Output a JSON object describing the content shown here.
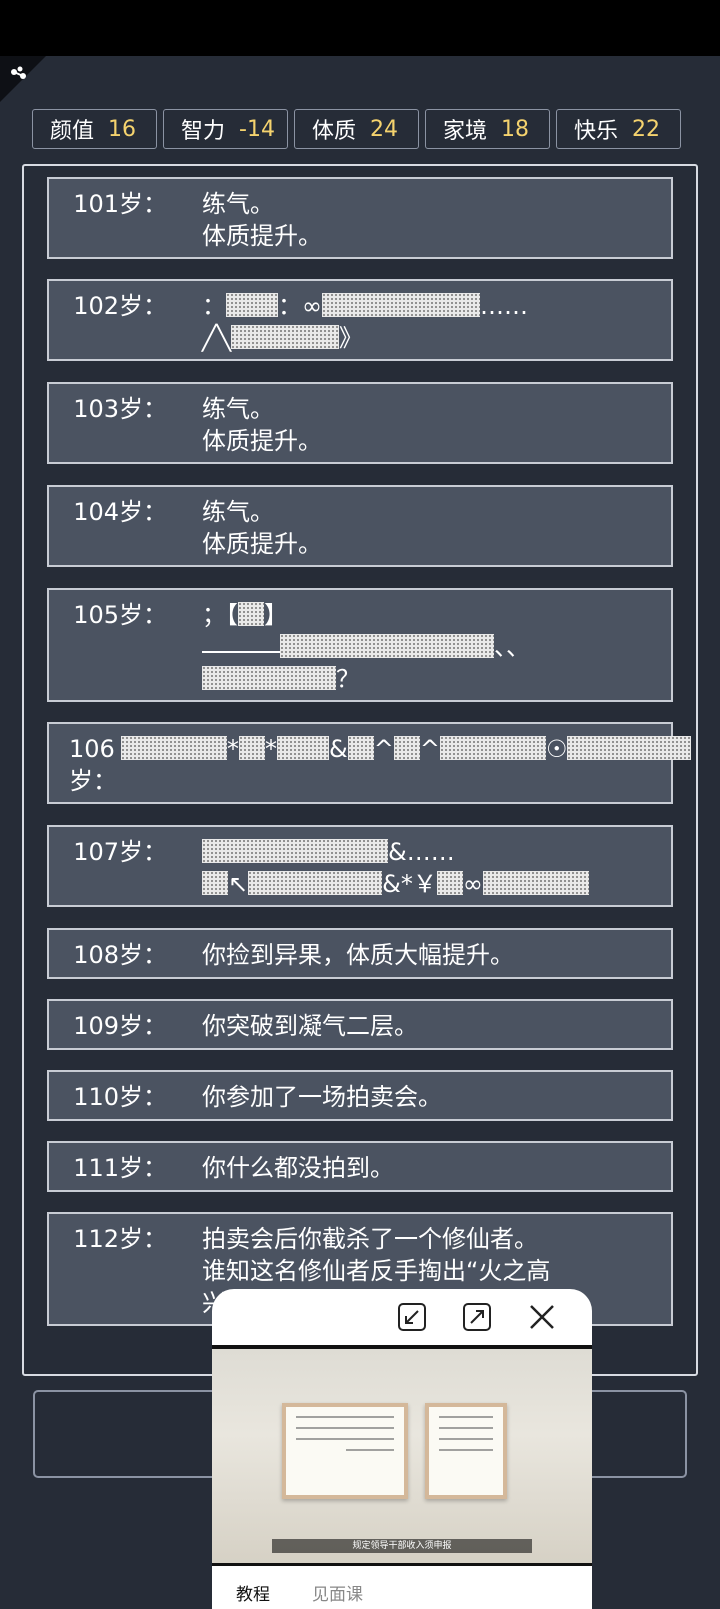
{
  "stats": [
    {
      "label": "颜值",
      "value": "16"
    },
    {
      "label": "智力",
      "value": "-14"
    },
    {
      "label": "体质",
      "value": "24"
    },
    {
      "label": "家境",
      "value": "18"
    },
    {
      "label": "快乐",
      "value": "22"
    }
  ],
  "log": [
    {
      "age": "101岁：",
      "lines": [
        "练气。",
        "体质提升。"
      ]
    },
    {
      "age": "102岁：",
      "lines": [
        "：",
        "：∞",
        "……",
        "╱╲",
        "》"
      ]
    },
    {
      "age": "103岁：",
      "lines": [
        "练气。",
        "体质提升。"
      ]
    },
    {
      "age": "104岁：",
      "lines": [
        "练气。",
        "体质提升。"
      ]
    },
    {
      "age": "105岁：",
      "lines": [
        "；【",
        "】",
        "、、",
        "？"
      ]
    },
    {
      "age": "106岁：",
      "lines": [
        "*",
        "*",
        "&",
        "^",
        "^",
        "☉"
      ]
    },
    {
      "age": "107岁：",
      "lines": [
        "&……",
        "↖",
        "&*￥",
        "∞"
      ]
    },
    {
      "age": "108岁：",
      "lines": [
        "你捡到异果，体质大幅提升。"
      ]
    },
    {
      "age": "109岁：",
      "lines": [
        "你突破到凝气二层。"
      ]
    },
    {
      "age": "110岁：",
      "lines": [
        "你参加了一场拍卖会。"
      ]
    },
    {
      "age": "111岁：",
      "lines": [
        "你什么都没拍到。"
      ]
    },
    {
      "age": "112岁：",
      "lines": [
        "拍卖会后你截杀了一个修仙者。",
        "谁知这名修仙者反手掏出“火之高",
        "兴”一挥，你人没了。"
      ]
    }
  ],
  "floating_window": {
    "video_caption": "规定领导干部收入须申报",
    "tabs": [
      "教程",
      "见面课"
    ],
    "buttons": [
      "collapse-icon",
      "expand-icon",
      "close-icon"
    ]
  },
  "colors": {
    "background": "#262c37",
    "row": "#4b5361",
    "stat_value": "#f5d36e"
  }
}
